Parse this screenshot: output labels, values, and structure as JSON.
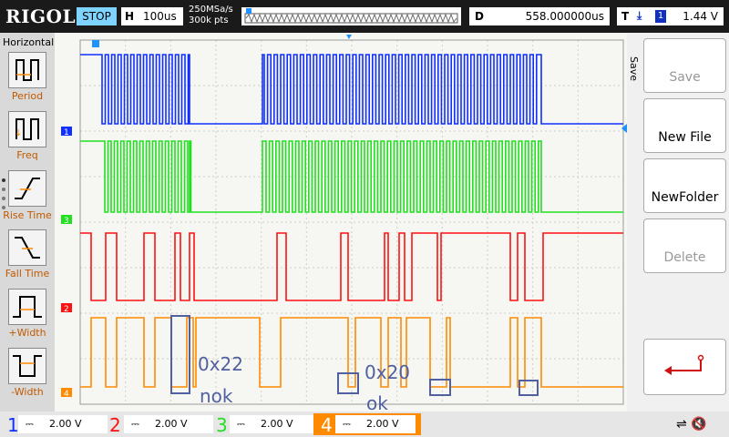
{
  "topbar": {
    "brand": "RIGOL",
    "run_state": "STOP",
    "horizontal_key": "H",
    "timebase": "100us",
    "sample_rate": "250MSa/s",
    "memory_depth": "300k pts",
    "delay_key": "D",
    "delay_value": "558.000000us",
    "trigger_key": "T",
    "trigger_icon": "trigger-edge-icon",
    "trigger_source": "1",
    "trigger_level": "1.44 V"
  },
  "left_menu": {
    "title": "Horizontal",
    "items": [
      {
        "label": "Period",
        "icon": "period-icon"
      },
      {
        "label": "Freq",
        "icon": "freq-icon"
      },
      {
        "label": "Rise Time",
        "icon": "rise-time-icon"
      },
      {
        "label": "Fall Time",
        "icon": "fall-time-icon"
      },
      {
        "label": "+Width",
        "icon": "pos-width-icon"
      },
      {
        "label": "-Width",
        "icon": "neg-width-icon"
      }
    ]
  },
  "right_menu": {
    "title": "Save",
    "buttons": [
      {
        "label": "Save",
        "enabled": false
      },
      {
        "label": "New File",
        "enabled": true
      },
      {
        "label": "NewFolder",
        "enabled": true
      },
      {
        "label": "Delete",
        "enabled": false
      }
    ],
    "back_icon": "return-arrow-icon"
  },
  "channels": [
    {
      "num": "1",
      "scale": "2.00 V",
      "color": "#1030ff",
      "coupling_icon": "dc-coupling-icon"
    },
    {
      "num": "2",
      "scale": "2.00 V",
      "color": "#ff1010",
      "coupling_icon": "dc-coupling-icon"
    },
    {
      "num": "3",
      "scale": "2.00 V",
      "color": "#20e020",
      "coupling_icon": "dc-coupling-icon"
    },
    {
      "num": "4",
      "scale": "2.00 V",
      "color": "#ff8a00",
      "coupling_icon": "dc-coupling-icon"
    }
  ],
  "annotations": {
    "label_a_value": "0x22",
    "label_a_status": "nok",
    "label_b_value": "0x20",
    "label_b_status": "ok",
    "color": "#5060a0"
  },
  "colors": {
    "ch1": "#1030ff",
    "ch2": "#ff1010",
    "ch3": "#20e020",
    "ch4": "#ff8a00",
    "run_state_bg": "#7fd3ff"
  }
}
